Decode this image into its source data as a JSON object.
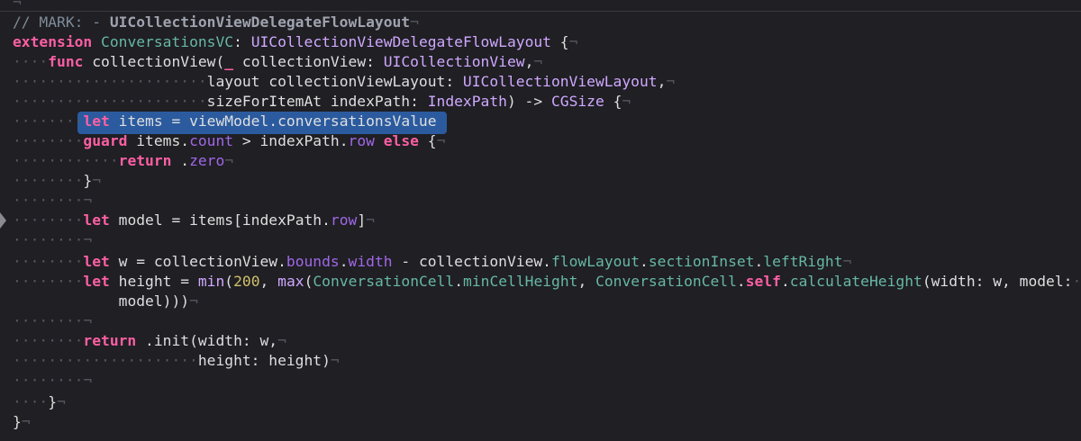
{
  "editor": {
    "language": "swift",
    "selection": {
      "line_index": 6,
      "text": "let items = viewModel.conversationsValue"
    },
    "lines": [
      {
        "tokens": [
          {
            "t": "¬",
            "c": "inv"
          }
        ]
      },
      {
        "tokens": [
          {
            "t": "// MARK: - ",
            "c": "comment"
          },
          {
            "t": "UICollectionViewDelegateFlowLayout",
            "c": "bold"
          },
          {
            "t": "¬",
            "c": "inv"
          }
        ]
      },
      {
        "tokens": [
          {
            "t": "extension",
            "c": "kw"
          },
          {
            "t": " ",
            "c": "ident"
          },
          {
            "t": "ConversationsVC",
            "c": "proj"
          },
          {
            "t": ": ",
            "c": "ident"
          },
          {
            "t": "UICollectionViewDelegateFlowLayout",
            "c": "type"
          },
          {
            "t": " {",
            "c": "ident"
          },
          {
            "t": "¬",
            "c": "inv"
          }
        ]
      },
      {
        "tokens": [
          {
            "t": "····",
            "c": "inv"
          },
          {
            "t": "func",
            "c": "kw"
          },
          {
            "t": " collectionView(",
            "c": "ident"
          },
          {
            "t": "_",
            "c": "kw"
          },
          {
            "t": " collectionView: ",
            "c": "ident"
          },
          {
            "t": "UICollectionView",
            "c": "type"
          },
          {
            "t": ",",
            "c": "ident"
          },
          {
            "t": "¬",
            "c": "inv"
          }
        ]
      },
      {
        "tokens": [
          {
            "t": "······················",
            "c": "inv"
          },
          {
            "t": "layout collectionViewLayout: ",
            "c": "ident"
          },
          {
            "t": "UICollectionViewLayout",
            "c": "type"
          },
          {
            "t": ",",
            "c": "ident"
          },
          {
            "t": "¬",
            "c": "inv"
          }
        ]
      },
      {
        "tokens": [
          {
            "t": "······················",
            "c": "inv"
          },
          {
            "t": "sizeForItemAt indexPath: ",
            "c": "ident"
          },
          {
            "t": "IndexPath",
            "c": "type"
          },
          {
            "t": ") -> ",
            "c": "ident"
          },
          {
            "t": "CGSize",
            "c": "type"
          },
          {
            "t": " {",
            "c": "ident"
          },
          {
            "t": "¬",
            "c": "inv"
          }
        ]
      },
      {
        "tokens": [
          {
            "t": "········",
            "c": "inv"
          },
          {
            "t": "let",
            "c": "kw"
          },
          {
            "t": " items = viewModel.conversationsValue",
            "c": "ident"
          }
        ]
      },
      {
        "tokens": [
          {
            "t": "········",
            "c": "inv"
          },
          {
            "t": "guard",
            "c": "kw"
          },
          {
            "t": " items.",
            "c": "ident"
          },
          {
            "t": "count",
            "c": "prop"
          },
          {
            "t": " > indexPath.",
            "c": "ident"
          },
          {
            "t": "row",
            "c": "prop"
          },
          {
            "t": " ",
            "c": "ident"
          },
          {
            "t": "else",
            "c": "kw"
          },
          {
            "t": " {",
            "c": "ident"
          },
          {
            "t": "¬",
            "c": "inv"
          }
        ]
      },
      {
        "tokens": [
          {
            "t": "············",
            "c": "inv"
          },
          {
            "t": "return",
            "c": "kw"
          },
          {
            "t": " .",
            "c": "ident"
          },
          {
            "t": "zero",
            "c": "prop"
          },
          {
            "t": "¬",
            "c": "inv"
          }
        ]
      },
      {
        "tokens": [
          {
            "t": "········",
            "c": "inv"
          },
          {
            "t": "}",
            "c": "ident"
          },
          {
            "t": "¬",
            "c": "inv"
          }
        ]
      },
      {
        "tokens": [
          {
            "t": "········¬",
            "c": "inv"
          }
        ]
      },
      {
        "tokens": [
          {
            "t": "········",
            "c": "inv"
          },
          {
            "t": "let",
            "c": "kw"
          },
          {
            "t": " model = items[indexPath.",
            "c": "ident"
          },
          {
            "t": "row",
            "c": "prop"
          },
          {
            "t": "]",
            "c": "ident"
          },
          {
            "t": "¬",
            "c": "inv"
          }
        ]
      },
      {
        "tokens": [
          {
            "t": "········¬",
            "c": "inv"
          }
        ]
      },
      {
        "tokens": [
          {
            "t": "········",
            "c": "inv"
          },
          {
            "t": "let",
            "c": "kw"
          },
          {
            "t": " w = collectionView.",
            "c": "ident"
          },
          {
            "t": "bounds",
            "c": "prop"
          },
          {
            "t": ".",
            "c": "ident"
          },
          {
            "t": "width",
            "c": "prop"
          },
          {
            "t": " - collectionView.",
            "c": "ident"
          },
          {
            "t": "flowLayout",
            "c": "proj"
          },
          {
            "t": ".",
            "c": "ident"
          },
          {
            "t": "sectionInset",
            "c": "proj"
          },
          {
            "t": ".",
            "c": "ident"
          },
          {
            "t": "leftRight",
            "c": "proj"
          },
          {
            "t": "¬",
            "c": "inv"
          }
        ]
      },
      {
        "tokens": [
          {
            "t": "········",
            "c": "inv"
          },
          {
            "t": "let",
            "c": "kw"
          },
          {
            "t": " height = ",
            "c": "ident"
          },
          {
            "t": "min",
            "c": "type"
          },
          {
            "t": "(",
            "c": "ident"
          },
          {
            "t": "200",
            "c": "num"
          },
          {
            "t": ", ",
            "c": "ident"
          },
          {
            "t": "max",
            "c": "type"
          },
          {
            "t": "(",
            "c": "ident"
          },
          {
            "t": "ConversationCell",
            "c": "proj"
          },
          {
            "t": ".",
            "c": "ident"
          },
          {
            "t": "minCellHeight",
            "c": "proj"
          },
          {
            "t": ", ",
            "c": "ident"
          },
          {
            "t": "ConversationCell",
            "c": "proj"
          },
          {
            "t": ".",
            "c": "ident"
          },
          {
            "t": "self",
            "c": "kw"
          },
          {
            "t": ".",
            "c": "ident"
          },
          {
            "t": "calculateHeight",
            "c": "proj"
          },
          {
            "t": "(width: w, model:",
            "c": "ident"
          },
          {
            "t": "·",
            "c": "inv"
          }
        ]
      },
      {
        "tokens": [
          {
            "t": "            ",
            "c": "ident"
          },
          {
            "t": "model)))",
            "c": "ident"
          },
          {
            "t": "¬",
            "c": "inv"
          }
        ]
      },
      {
        "tokens": [
          {
            "t": "········¬",
            "c": "inv"
          }
        ]
      },
      {
        "tokens": [
          {
            "t": "········",
            "c": "inv"
          },
          {
            "t": "return",
            "c": "kw"
          },
          {
            "t": " .init(width: w,",
            "c": "ident"
          },
          {
            "t": "¬",
            "c": "inv"
          }
        ]
      },
      {
        "tokens": [
          {
            "t": "·····················",
            "c": "inv"
          },
          {
            "t": "height: height)",
            "c": "ident"
          },
          {
            "t": "¬",
            "c": "inv"
          }
        ]
      },
      {
        "tokens": [
          {
            "t": "········¬",
            "c": "inv"
          }
        ]
      },
      {
        "tokens": [
          {
            "t": "····",
            "c": "inv"
          },
          {
            "t": "}",
            "c": "ident"
          },
          {
            "t": "¬",
            "c": "inv"
          }
        ]
      },
      {
        "tokens": [
          {
            "t": "}",
            "c": "ident"
          },
          {
            "t": "¬",
            "c": "inv"
          }
        ]
      }
    ]
  }
}
